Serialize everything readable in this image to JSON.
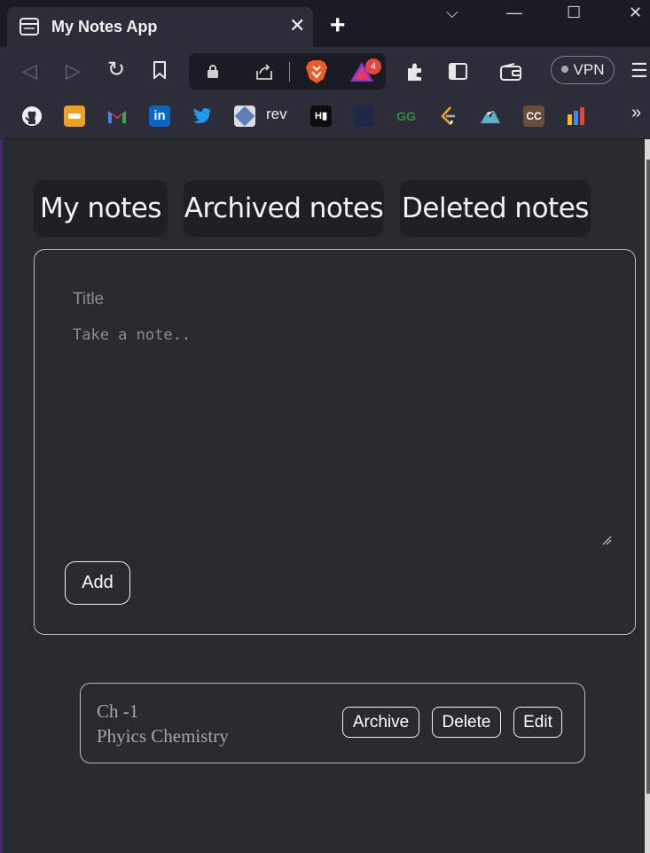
{
  "browser": {
    "tab_title": "My Notes App",
    "tab_close": "✕",
    "new_tab": "+",
    "window_controls": {
      "tab_search": "⌵",
      "minimize": "—",
      "maximize": "☐",
      "close": "✕"
    },
    "toolbar": {
      "back": "◁",
      "forward": "▷",
      "reload": "↻",
      "brave_rewards_badge": "4",
      "vpn_label": "VPN",
      "menu": "☰"
    },
    "bookmarks": {
      "icons": [
        "github-icon",
        "bookmark-orange-icon",
        "gmail-icon",
        "linkedin-icon",
        "twitter-icon",
        "bookmark-rev-icon",
        "hackerrank-icon",
        "bookmark-dark-icon",
        "geeksforgeeks-icon",
        "leetcode-icon",
        "bookmark-mountain-icon",
        "codechef-icon",
        "analytics-icon"
      ],
      "rev_label": "rev",
      "overflow": "»"
    }
  },
  "app": {
    "nav": {
      "my_notes": "My notes",
      "archived_notes": "Archived notes",
      "deleted_notes": "Deleted notes"
    },
    "form": {
      "title_placeholder": "Title",
      "note_placeholder": "Take a note..",
      "add_label": "Add"
    },
    "notes": [
      {
        "title": "Ch -1",
        "body": "Phyics Chemistry",
        "archive_label": "Archive",
        "delete_label": "Delete",
        "edit_label": "Edit"
      }
    ]
  },
  "colors": {
    "page_background": "#282a2f",
    "nav_button_background": "#1e1f22",
    "border": "#bcbcbc",
    "placeholder_text": "#8d8e93"
  }
}
